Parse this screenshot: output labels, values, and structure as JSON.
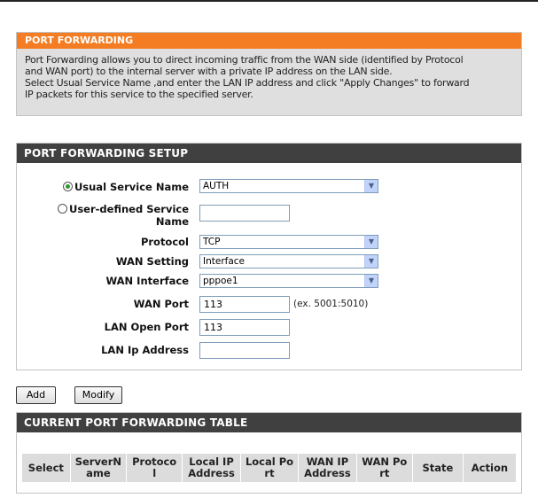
{
  "intro": {
    "title": "PORT FORWARDING",
    "line1": "Port Forwarding allows you to direct incoming traffic from the WAN side (identified by Protocol",
    "line2": "and WAN port) to the internal server with a private IP address on the LAN side.",
    "line3": "Select Usual Service Name ,and enter the LAN IP address and click \"Apply Changes\" to forward",
    "line4": "IP packets for this service to the specified server."
  },
  "setup": {
    "title": "PORT FORWARDING SETUP",
    "usual_service_label": "Usual Service Name",
    "usual_service_value": "AUTH",
    "user_defined_label_1": "User-defined Service",
    "user_defined_label_2": "Name",
    "user_defined_value": "",
    "protocol_label": "Protocol",
    "protocol_value": "TCP",
    "wan_setting_label": "WAN Setting",
    "wan_setting_value": "Interface",
    "wan_interface_label": "WAN Interface",
    "wan_interface_value": "pppoe1",
    "wan_port_label": "WAN Port",
    "wan_port_value": "113",
    "wan_port_hint": "(ex. 5001:5010)",
    "lan_open_port_label": "LAN Open Port",
    "lan_open_port_value": "113",
    "lan_ip_label": "LAN Ip Address",
    "lan_ip_value": ""
  },
  "buttons": {
    "add": "Add",
    "modify": "Modify"
  },
  "table": {
    "title": "CURRENT PORT FORWARDING TABLE",
    "headers": [
      [
        "Select"
      ],
      [
        "ServerN",
        "ame"
      ],
      [
        "Protoco",
        "l"
      ],
      [
        "Local IP",
        "Address"
      ],
      [
        "Local Po",
        "rt"
      ],
      [
        "WAN IP",
        "Address"
      ],
      [
        "WAN Po",
        "rt"
      ],
      [
        "State"
      ],
      [
        "Action"
      ]
    ]
  },
  "colors": {
    "orange_header": "#f47c22",
    "dark_header": "#404040",
    "intro_bg": "#dfdfdf",
    "table_header_bg": "#dcdcdc"
  }
}
